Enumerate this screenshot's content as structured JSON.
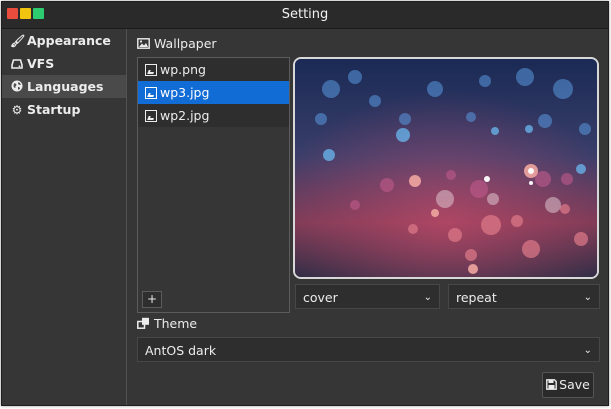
{
  "window": {
    "title": "Setting"
  },
  "sidebar": {
    "items": [
      {
        "label": "Appearance",
        "icon": "brush-icon"
      },
      {
        "label": "VFS",
        "icon": "hdd-icon"
      },
      {
        "label": "Languages",
        "icon": "globe-icon"
      },
      {
        "label": "Startup",
        "icon": "gear-icon"
      }
    ],
    "active_index": 2
  },
  "wallpaper": {
    "label": "Wallpaper",
    "files": [
      {
        "name": "wp.png"
      },
      {
        "name": "wp3.jpg"
      },
      {
        "name": "wp2.jpg"
      }
    ],
    "selected_index": 1,
    "add_label": "+",
    "size_mode": "cover",
    "repeat_mode": "repeat"
  },
  "theme": {
    "label": "Theme",
    "value": "AntOS dark"
  },
  "actions": {
    "save_label": "Save"
  },
  "colors": {
    "background": "#363636",
    "titlebar": "#2a2a2a",
    "selection": "#116cd6",
    "close": "#e74c3c",
    "minimize": "#f1c40f",
    "maximize": "#2ecc71"
  }
}
